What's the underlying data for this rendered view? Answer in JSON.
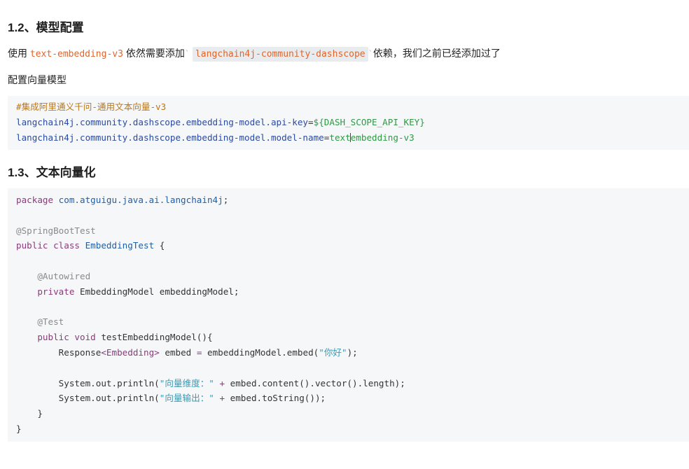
{
  "section_1_2": {
    "title": "1.2、模型配置",
    "para_prefix": "使用 ",
    "para_code1": "text-embedding-v3",
    "para_mid": " 依然需要添加",
    "para_code2": "langchain4j-community-dashscope",
    "para_suffix": "依赖，我们之前已经添加过了",
    "subheading": "配置向量模型",
    "config_comment": "#集成阿里通义千问-通用文本向量-v3",
    "config_line1_key": "langchain4j.community.dashscope.embedding-model.api-key",
    "config_line1_eq": "=",
    "config_line1_val": "${DASH_SCOPE_API_KEY}",
    "config_line2_key": "langchain4j.community.dashscope.embedding-model.model-name",
    "config_line2_eq": "=",
    "config_line2_val_a": "text",
    "config_line2_val_b": "embedding-v3"
  },
  "section_1_3": {
    "title": "1.3、文本向量化",
    "code": {
      "l1_kw": "package",
      "l1_pkg": " com.atguigu.java.ai.langchain4j",
      "l1_end": ";",
      "l3_ann": "@SpringBootTest",
      "l4_kw": "public class",
      "l4_name": " EmbeddingTest",
      "l4_end": " {",
      "l6_ann": "@Autowired",
      "l7_kw": "private",
      "l7_rest": " EmbeddingModel embeddingModel;",
      "l9_ann": "@Test",
      "l10_kw": "public void",
      "l10_rest": " testEmbeddingModel(){",
      "l11_a": "Response",
      "l11_b": "<Embedding>",
      "l11_c": " embed ",
      "l11_d": "=",
      "l11_e": " embeddingModel.embed(",
      "l11_str": "\"你好\"",
      "l11_end": ");",
      "l13_a": "System.out.println(",
      "l13_str": "\"向量维度：\"",
      "l13_op": " + ",
      "l13_end": "embed.content().vector().length);",
      "l14_a": "System.out.println(",
      "l14_str": "\"向量输出：\"",
      "l14_op": " + ",
      "l14_end": "embed.toString());",
      "l15": "}",
      "l16": "}"
    }
  }
}
